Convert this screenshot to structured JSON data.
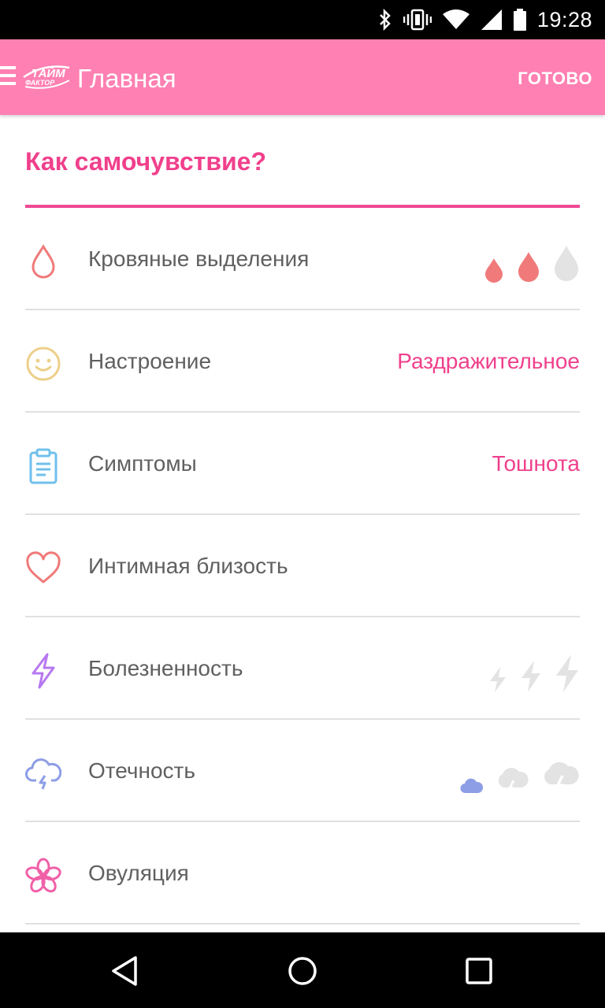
{
  "status_bar": {
    "time": "19:28",
    "icons": [
      "bluetooth-icon",
      "vibrate-icon",
      "wifi-icon",
      "signal-icon",
      "battery-icon"
    ]
  },
  "app_bar": {
    "logo_text_top": "ТАЙМ",
    "logo_text_bottom": "ФАКТОР",
    "title": "Главная",
    "done_label": "ГОТОВО"
  },
  "section": {
    "title": "Как самочувствие?"
  },
  "rows": [
    {
      "icon": "drop-icon",
      "label": "Кровяные выделения",
      "level": 2,
      "level_max": 3
    },
    {
      "icon": "smile-icon",
      "label": "Настроение",
      "value": "Раздражительное"
    },
    {
      "icon": "clipboard-icon",
      "label": "Симптомы",
      "value": "Тошнота"
    },
    {
      "icon": "heart-icon",
      "label": "Интимная близость"
    },
    {
      "icon": "lightning-icon",
      "label": "Болезненность",
      "level": 0,
      "level_max": 3
    },
    {
      "icon": "cloud-icon",
      "label": "Отечность",
      "level": 1,
      "level_max": 3
    },
    {
      "icon": "flower-icon",
      "label": "Овуляция"
    }
  ],
  "colors": {
    "app_bar": "#ff80b2",
    "accent": "#f0408c",
    "drop_active": "#f07a7a",
    "lightning_icon": "#b678f0",
    "cloud_active": "#8d9ee6",
    "inactive_level": "#e3e3e3"
  },
  "nav_bar": {
    "icons": [
      "back-icon",
      "home-icon",
      "recents-icon"
    ]
  }
}
